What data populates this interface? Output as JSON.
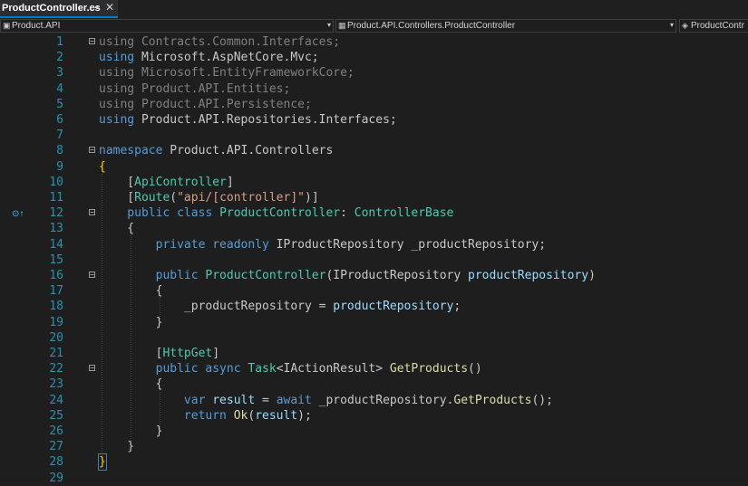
{
  "tab": {
    "title": "ProductController.cs",
    "pin": "⊸",
    "close": "✕"
  },
  "nav": {
    "project": "Product.API",
    "type": "Product.API.Controllers.ProductController",
    "member": "ProductContr"
  },
  "codelens": "⊙↑",
  "lines": [
    {
      "n": "1",
      "segs": [
        {
          "c": "gr",
          "t": "using "
        },
        {
          "c": "gr",
          "t": "Contracts.Common.Interfaces"
        },
        {
          "c": "gr",
          "t": ";"
        }
      ]
    },
    {
      "n": "2",
      "segs": [
        {
          "c": "kw",
          "t": "using "
        },
        {
          "c": "fl",
          "t": "Microsoft.AspNetCore.Mvc;"
        }
      ]
    },
    {
      "n": "3",
      "segs": [
        {
          "c": "gr",
          "t": "using Microsoft.EntityFrameworkCore;"
        }
      ]
    },
    {
      "n": "4",
      "segs": [
        {
          "c": "gr",
          "t": "using Product.API.Entities;"
        }
      ]
    },
    {
      "n": "5",
      "segs": [
        {
          "c": "gr",
          "t": "using Product.API.Persistence;"
        }
      ]
    },
    {
      "n": "6",
      "segs": [
        {
          "c": "kw",
          "t": "using "
        },
        {
          "c": "fl",
          "t": "Product.API.Repositories.Interfaces;"
        }
      ]
    },
    {
      "n": "7",
      "segs": []
    },
    {
      "n": "8",
      "segs": [
        {
          "c": "kw",
          "t": "namespace "
        },
        {
          "c": "fl",
          "t": "Product.API.Controllers"
        }
      ]
    },
    {
      "n": "9",
      "segs": [
        {
          "c": "br",
          "t": "{"
        }
      ]
    },
    {
      "n": "10",
      "segs": [
        {
          "c": "fl",
          "t": "    ["
        },
        {
          "c": "ty",
          "t": "ApiController"
        },
        {
          "c": "fl",
          "t": "]"
        }
      ]
    },
    {
      "n": "11",
      "segs": [
        {
          "c": "fl",
          "t": "    ["
        },
        {
          "c": "ty",
          "t": "Route"
        },
        {
          "c": "fl",
          "t": "("
        },
        {
          "c": "st",
          "t": "\"api/[controller]\""
        },
        {
          "c": "fl",
          "t": ")]"
        }
      ]
    },
    {
      "n": "12",
      "segs": [
        {
          "c": "kw",
          "t": "    public class "
        },
        {
          "c": "ty",
          "t": "ProductController"
        },
        {
          "c": "fl",
          "t": ": "
        },
        {
          "c": "ty",
          "t": "ControllerBase"
        }
      ]
    },
    {
      "n": "13",
      "segs": [
        {
          "c": "fl",
          "t": "    {"
        }
      ]
    },
    {
      "n": "14",
      "segs": [
        {
          "c": "kw",
          "t": "        private readonly "
        },
        {
          "c": "fl",
          "t": "IProductRepository _productRepository;"
        }
      ]
    },
    {
      "n": "15",
      "segs": []
    },
    {
      "n": "16",
      "segs": [
        {
          "c": "kw",
          "t": "        public "
        },
        {
          "c": "ty",
          "t": "ProductController"
        },
        {
          "c": "fl",
          "t": "(IProductRepository "
        },
        {
          "c": "pa",
          "t": "productRepository"
        },
        {
          "c": "fl",
          "t": ")"
        }
      ]
    },
    {
      "n": "17",
      "segs": [
        {
          "c": "fl",
          "t": "        {"
        }
      ]
    },
    {
      "n": "18",
      "segs": [
        {
          "c": "fl",
          "t": "            _productRepository = "
        },
        {
          "c": "pa",
          "t": "productRepository"
        },
        {
          "c": "fl",
          "t": ";"
        }
      ]
    },
    {
      "n": "19",
      "segs": [
        {
          "c": "fl",
          "t": "        }"
        }
      ]
    },
    {
      "n": "20",
      "segs": []
    },
    {
      "n": "21",
      "segs": [
        {
          "c": "fl",
          "t": "        ["
        },
        {
          "c": "ty",
          "t": "HttpGet"
        },
        {
          "c": "fl",
          "t": "]"
        }
      ]
    },
    {
      "n": "22",
      "segs": [
        {
          "c": "kw",
          "t": "        public async "
        },
        {
          "c": "ty",
          "t": "Task"
        },
        {
          "c": "fl",
          "t": "<IActionResult> "
        },
        {
          "c": "fn",
          "t": "GetProducts"
        },
        {
          "c": "fl",
          "t": "()"
        }
      ]
    },
    {
      "n": "23",
      "segs": [
        {
          "c": "fl",
          "t": "        {"
        }
      ]
    },
    {
      "n": "24",
      "segs": [
        {
          "c": "kw",
          "t": "            var "
        },
        {
          "c": "pa",
          "t": "result"
        },
        {
          "c": "fl",
          "t": " = "
        },
        {
          "c": "kw",
          "t": "await "
        },
        {
          "c": "fl",
          "t": "_productRepository."
        },
        {
          "c": "fn",
          "t": "GetProducts"
        },
        {
          "c": "fl",
          "t": "();"
        }
      ]
    },
    {
      "n": "25",
      "segs": [
        {
          "c": "kw",
          "t": "            return "
        },
        {
          "c": "fn",
          "t": "Ok"
        },
        {
          "c": "fl",
          "t": "("
        },
        {
          "c": "pa",
          "t": "result"
        },
        {
          "c": "fl",
          "t": ");"
        }
      ]
    },
    {
      "n": "26",
      "segs": [
        {
          "c": "fl",
          "t": "        }"
        }
      ]
    },
    {
      "n": "27",
      "segs": [
        {
          "c": "fl",
          "t": "    }"
        }
      ]
    },
    {
      "n": "28",
      "segs": [
        {
          "c": "br",
          "t": "}"
        }
      ]
    },
    {
      "n": "29",
      "segs": []
    }
  ],
  "fold_lines": [
    "1",
    "8",
    "12",
    "16",
    "22"
  ]
}
